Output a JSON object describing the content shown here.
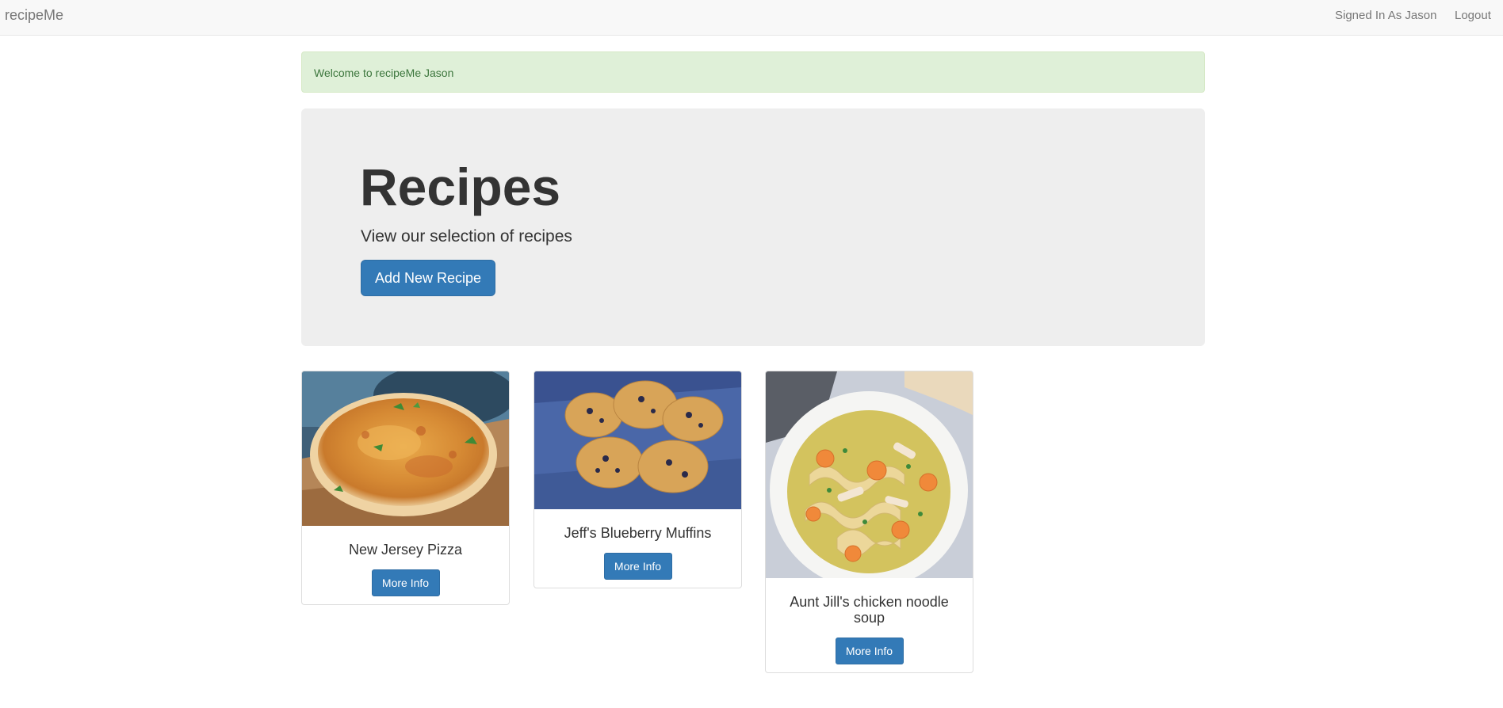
{
  "navbar": {
    "brand": "recipeMe",
    "signed_in": "Signed In As Jason",
    "logout": "Logout"
  },
  "alert": {
    "message": "Welcome to recipeMe Jason"
  },
  "jumbotron": {
    "title": "Recipes",
    "subtitle": "View our selection of recipes",
    "add_button": "Add New Recipe"
  },
  "recipes": [
    {
      "title": "New Jersey Pizza",
      "button": "More Info",
      "image": "pizza-photo"
    },
    {
      "title": "Jeff's Blueberry Muffins",
      "button": "More Info",
      "image": "blueberry-muffins-photo"
    },
    {
      "title": "Aunt Jill's chicken noodle soup",
      "button": "More Info",
      "image": "chicken-noodle-soup-photo"
    }
  ],
  "colors": {
    "primary": "#337ab7",
    "alert_bg": "#dff0d8",
    "alert_text": "#3c763d",
    "jumbotron_bg": "#eeeeee",
    "navbar_bg": "#f8f8f8"
  }
}
